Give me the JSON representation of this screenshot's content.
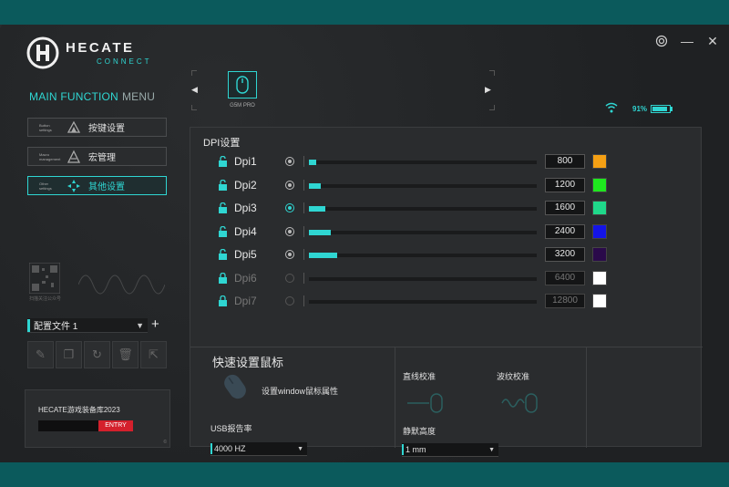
{
  "app": {
    "brand": "HECATE",
    "sub": "CONNECT"
  },
  "window_controls": {
    "settings_icon": "gear-icon",
    "minimize_icon": "minimize-icon",
    "close_icon": "close-icon",
    "minimize_glyph": "—",
    "close_glyph": "✕"
  },
  "sidebar": {
    "title_main": "MAIN FUNCTION",
    "title_menu": "MENU",
    "items": [
      {
        "small": "Button settings",
        "label": "按键设置",
        "active": false
      },
      {
        "small": "Macro management",
        "label": "宏管理",
        "active": false
      },
      {
        "small": "Other settings",
        "label": "其他设置",
        "active": true
      }
    ],
    "qr_caption": "扫描关注公众号",
    "profile": {
      "label": "配置文件 1",
      "add": "+"
    },
    "tools": [
      "edit-icon",
      "copy-icon",
      "reset-icon",
      "delete-icon",
      "export-icon"
    ],
    "promo": {
      "title": "HECATE游戏装备库2023",
      "entry": "ENTRY",
      "copyright": "©"
    }
  },
  "device": {
    "prev": "◀",
    "next": "▶",
    "name": "G5M PRO"
  },
  "status": {
    "battery": "91%",
    "battery_level": 0.91,
    "accent": "#2fd6d2"
  },
  "dpi": {
    "title": "DPI设置",
    "rows": [
      {
        "name": "Dpi1",
        "value": "800",
        "color": "#f5a014",
        "fraction": 0.03,
        "selected": false,
        "enabled": true
      },
      {
        "name": "Dpi2",
        "value": "1200",
        "color": "#1ee81e",
        "fraction": 0.05,
        "selected": false,
        "enabled": true
      },
      {
        "name": "Dpi3",
        "value": "1600",
        "color": "#1fd88a",
        "fraction": 0.07,
        "selected": true,
        "enabled": true
      },
      {
        "name": "Dpi4",
        "value": "2400",
        "color": "#1414e6",
        "fraction": 0.095,
        "selected": false,
        "enabled": true
      },
      {
        "name": "Dpi5",
        "value": "3200",
        "color": "#2a0a4a",
        "fraction": 0.125,
        "selected": false,
        "enabled": true
      },
      {
        "name": "Dpi6",
        "value": "6400",
        "color": "#ffffff",
        "fraction": 0,
        "selected": false,
        "enabled": false
      },
      {
        "name": "Dpi7",
        "value": "12800",
        "color": "#ffffff",
        "fraction": 0,
        "selected": false,
        "enabled": false
      }
    ]
  },
  "quick": {
    "title": "快速设置鼠标",
    "win_mouse": "设置window鼠标属性",
    "usb_label": "USB报告率",
    "usb_value": "4000 HZ",
    "straight": "直线校准",
    "ripple": "波纹校准",
    "lod_label": "静默高度",
    "lod_value": "1 mm"
  }
}
